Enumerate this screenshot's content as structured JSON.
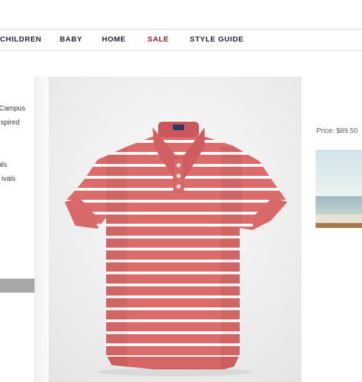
{
  "nav": {
    "items": [
      {
        "label": "CHILDREN"
      },
      {
        "label": "BABY"
      },
      {
        "label": "HOME"
      },
      {
        "label": "SALE"
      },
      {
        "label": "STYLE GUIDE"
      }
    ]
  },
  "sidebar": {
    "links": [
      "Campus",
      "spired",
      "als",
      "ivals"
    ]
  },
  "product": {
    "price_label": "Price: $89.50",
    "shirt_color": "#dc6b6b",
    "stripe_color": "#ffffff",
    "button_color": "#eae1d4",
    "label_color": "#2d3a66"
  },
  "colors": {
    "sale": "#8b1c2a",
    "nav_text": "#1c2433",
    "left_bar": "#a7a7a7"
  }
}
